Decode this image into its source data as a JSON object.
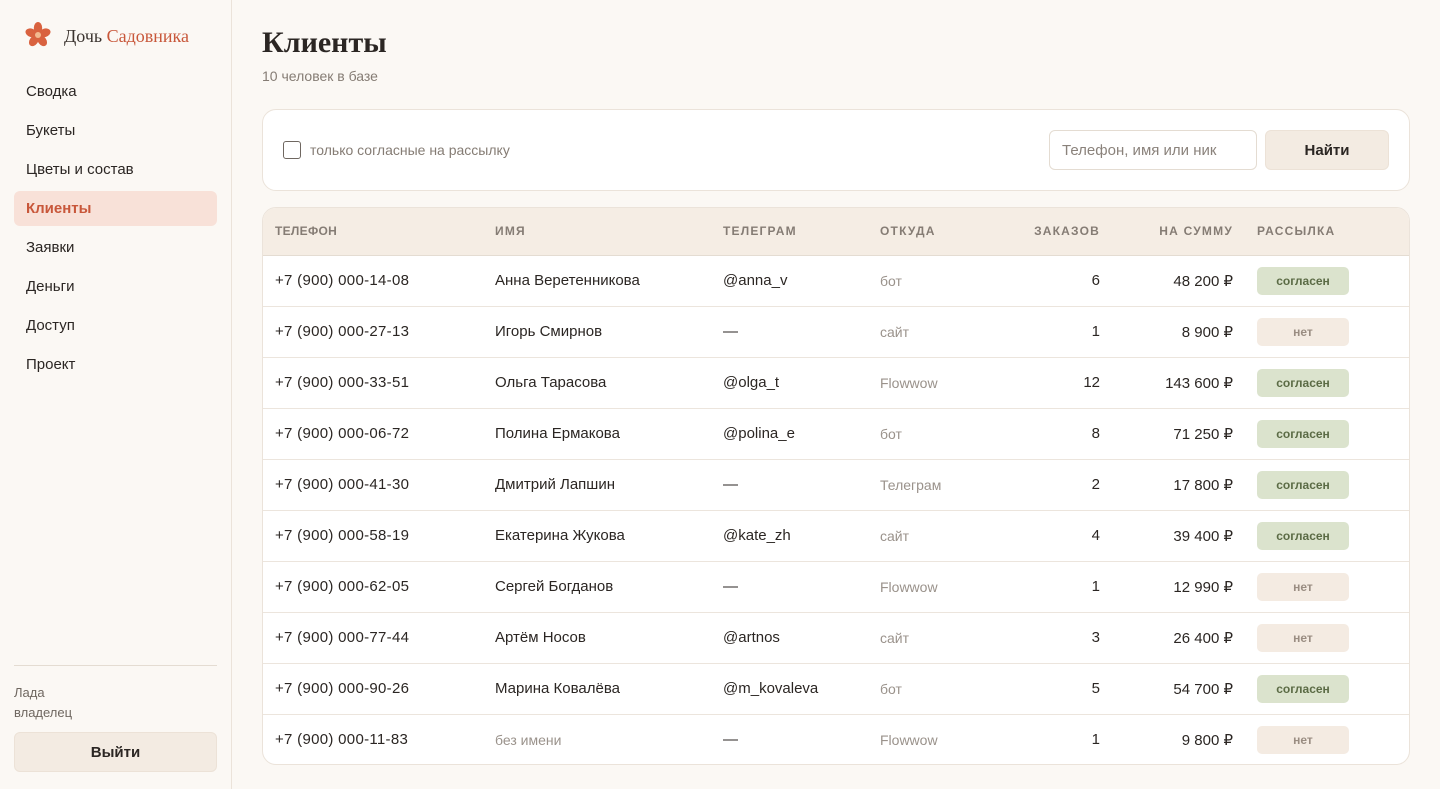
{
  "brand": {
    "name_part1": "Дочь",
    "name_part2": "Садовника",
    "accent_color": "#c8573a"
  },
  "nav": {
    "items": [
      {
        "label": "Сводка",
        "active": false
      },
      {
        "label": "Букеты",
        "active": false
      },
      {
        "label": "Цветы и состав",
        "active": false
      },
      {
        "label": "Клиенты",
        "active": true
      },
      {
        "label": "Заявки",
        "active": false
      },
      {
        "label": "Деньги",
        "active": false
      },
      {
        "label": "Доступ",
        "active": false
      },
      {
        "label": "Проект",
        "active": false
      }
    ]
  },
  "user": {
    "name": "Лада",
    "role": "владелец",
    "logout_label": "Выйти"
  },
  "page": {
    "title": "Клиенты",
    "subtitle": "10 человек в базе"
  },
  "filter": {
    "checkbox_label": "только согласные на рассылку",
    "checkbox_checked": false,
    "search_placeholder": "Телефон, имя или ник",
    "search_value": "",
    "search_button": "Найти"
  },
  "table": {
    "columns": [
      "ТЕЛЕФОН",
      "ИМЯ",
      "ТЕЛЕГРАМ",
      "ОТКУДА",
      "ЗАКАЗОВ",
      "НА СУММУ",
      "РАССЫЛКА"
    ],
    "rows": [
      {
        "phone": "+7 (900) 000-14-08",
        "name": "Анна Веретенникова",
        "telegram": "@anna_v",
        "source": "бот",
        "orders": "6",
        "sum": "48 200 ₽",
        "mailing": "согласен"
      },
      {
        "phone": "+7 (900) 000-27-13",
        "name": "Игорь Смирнов",
        "telegram": "—",
        "source": "сайт",
        "orders": "1",
        "sum": "8 900 ₽",
        "mailing": "нет"
      },
      {
        "phone": "+7 (900) 000-33-51",
        "name": "Ольга Тарасова",
        "telegram": "@olga_t",
        "source": "Flowwow",
        "orders": "12",
        "sum": "143 600 ₽",
        "mailing": "согласен"
      },
      {
        "phone": "+7 (900) 000-06-72",
        "name": "Полина Ермакова",
        "telegram": "@polina_e",
        "source": "бот",
        "orders": "8",
        "sum": "71 250 ₽",
        "mailing": "согласен"
      },
      {
        "phone": "+7 (900) 000-41-30",
        "name": "Дмитрий Лапшин",
        "telegram": "—",
        "source": "Телеграм",
        "orders": "2",
        "sum": "17 800 ₽",
        "mailing": "согласен"
      },
      {
        "phone": "+7 (900) 000-58-19",
        "name": "Екатерина Жукова",
        "telegram": "@kate_zh",
        "source": "сайт",
        "orders": "4",
        "sum": "39 400 ₽",
        "mailing": "согласен"
      },
      {
        "phone": "+7 (900) 000-62-05",
        "name": "Сергей Богданов",
        "telegram": "—",
        "source": "Flowwow",
        "orders": "1",
        "sum": "12 990 ₽",
        "mailing": "нет"
      },
      {
        "phone": "+7 (900) 000-77-44",
        "name": "Артём Носов",
        "telegram": "@artnos",
        "source": "сайт",
        "orders": "3",
        "sum": "26 400 ₽",
        "mailing": "нет"
      },
      {
        "phone": "+7 (900) 000-90-26",
        "name": "Марина Ковалёва",
        "telegram": "@m_kovaleva",
        "source": "бот",
        "orders": "5",
        "sum": "54 700 ₽",
        "mailing": "согласен"
      },
      {
        "phone": "+7 (900) 000-11-83",
        "name": "без имени",
        "telegram": "—",
        "source": "Flowwow",
        "orders": "1",
        "sum": "9 800 ₽",
        "mailing": "нет"
      }
    ]
  },
  "icons": {
    "brand": "flower-icon",
    "checkbox": "checkbox-icon"
  },
  "colors": {
    "badge_yes_bg": "#dbe3cd",
    "badge_no_bg": "#f4ebe2",
    "active_nav_bg": "#f8e1d8"
  }
}
